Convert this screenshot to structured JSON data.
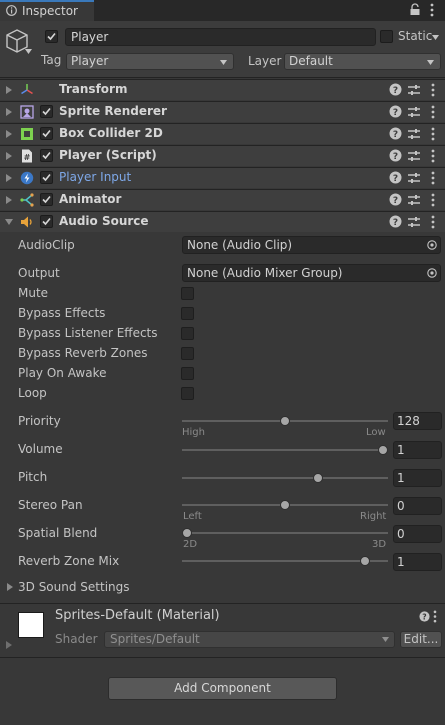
{
  "window": {
    "tab_title": "Inspector"
  },
  "header": {
    "active": true,
    "object_name": "Player",
    "static_label": "Static",
    "static_checked": false,
    "tag_label": "Tag",
    "tag_value": "Player",
    "layer_label": "Layer",
    "layer_value": "Default"
  },
  "components": [
    {
      "name": "Transform",
      "icon": "transform-icon",
      "has_checkbox": false,
      "expanded": false
    },
    {
      "name": "Sprite Renderer",
      "icon": "sprite-renderer-icon",
      "has_checkbox": true,
      "enabled": true,
      "expanded": false
    },
    {
      "name": "Box Collider 2D",
      "icon": "box-collider-icon",
      "has_checkbox": true,
      "enabled": true,
      "expanded": false
    },
    {
      "name": "Player (Script)",
      "icon": "script-icon",
      "has_checkbox": true,
      "enabled": true,
      "expanded": false
    },
    {
      "name": "Player Input",
      "icon": "player-input-icon",
      "has_checkbox": true,
      "enabled": true,
      "expanded": false
    },
    {
      "name": "Animator",
      "icon": "animator-icon",
      "has_checkbox": true,
      "enabled": true,
      "expanded": false
    },
    {
      "name": "Audio Source",
      "icon": "audio-source-icon",
      "has_checkbox": true,
      "enabled": true,
      "expanded": true
    }
  ],
  "audio_source": {
    "audioclip": {
      "label": "AudioClip",
      "value": "None (Audio Clip)"
    },
    "output": {
      "label": "Output",
      "value": "None (Audio Mixer Group)"
    },
    "toggles": [
      {
        "label": "Mute",
        "checked": false
      },
      {
        "label": "Bypass Effects",
        "checked": false
      },
      {
        "label": "Bypass Listener Effects",
        "checked": false
      },
      {
        "label": "Bypass Reverb Zones",
        "checked": false
      },
      {
        "label": "Play On Awake",
        "checked": false
      },
      {
        "label": "Loop",
        "checked": false
      }
    ],
    "sliders": [
      {
        "label": "Priority",
        "value": "128",
        "fraction": 0.5,
        "min_label": "High",
        "max_label": "Low"
      },
      {
        "label": "Volume",
        "value": "1",
        "fraction": 1.0
      },
      {
        "label": "Pitch",
        "value": "1",
        "fraction": 0.667
      },
      {
        "label": "Stereo Pan",
        "value": "0",
        "fraction": 0.5,
        "min_label": "Left",
        "max_label": "Right"
      },
      {
        "label": "Spatial Blend",
        "value": "0",
        "fraction": 0.0,
        "min_label": "2D",
        "max_label": "3D"
      },
      {
        "label": "Reverb Zone Mix",
        "value": "1",
        "fraction": 0.909
      }
    ],
    "sound_settings_label": "3D Sound Settings"
  },
  "material": {
    "name": "Sprites-Default (Material)",
    "shader_label": "Shader",
    "shader_value": "Sprites/Default",
    "edit_label": "Edit..."
  },
  "add_component_label": "Add Component",
  "colors": {
    "background": "#383838",
    "tab_accent": "#3a79bb",
    "link_blue": "#7ea8e8"
  }
}
